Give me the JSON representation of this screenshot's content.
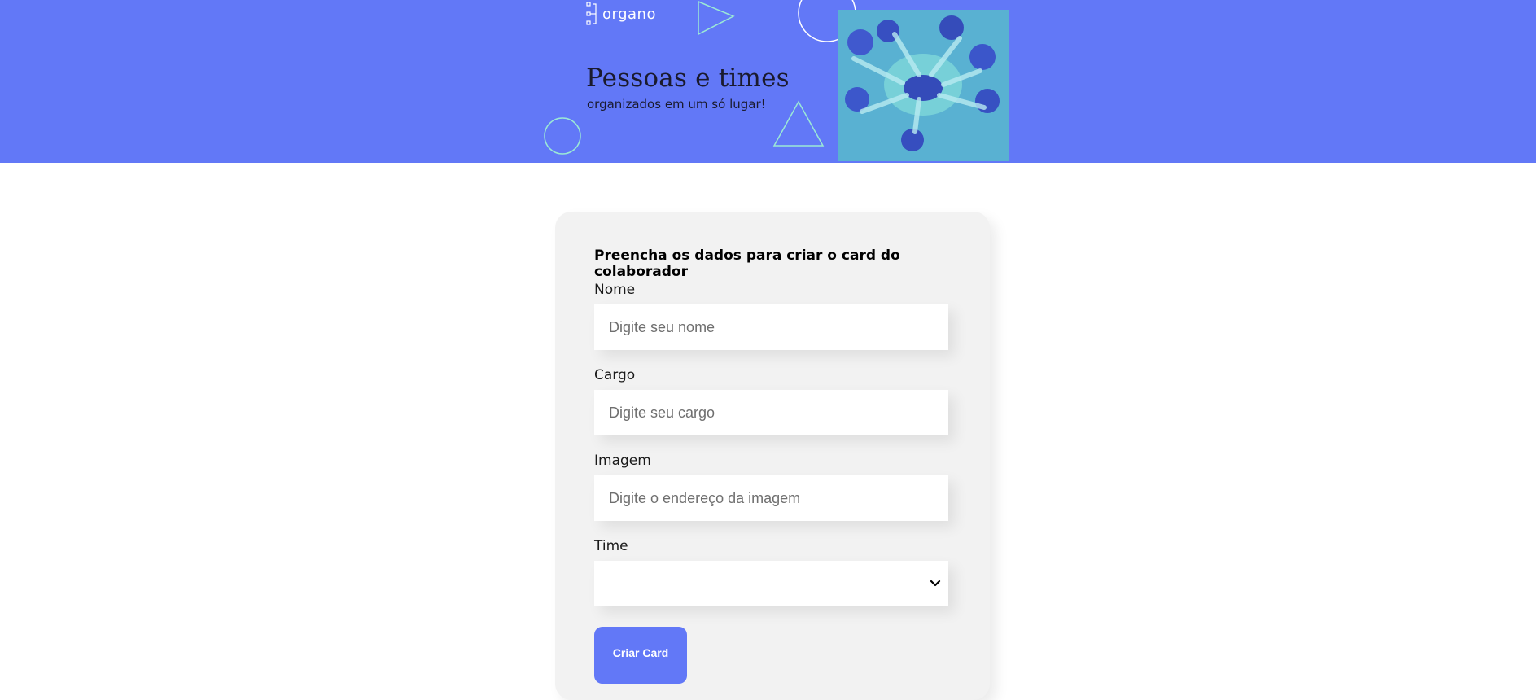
{
  "banner": {
    "logo_text": "organo",
    "headline": "Pessoas e times",
    "subline": "organizados em um só lugar!",
    "background_color": "#6278f7",
    "photo_tint": "#64e8c6"
  },
  "form": {
    "title": "Preencha os dados para criar o card do colaborador",
    "fields": {
      "nome": {
        "label": "Nome",
        "placeholder": "Digite seu nome",
        "value": ""
      },
      "cargo": {
        "label": "Cargo",
        "placeholder": "Digite seu cargo",
        "value": ""
      },
      "imagem": {
        "label": "Imagem",
        "placeholder": "Digite o endereço da imagem",
        "value": ""
      },
      "time": {
        "label": "Time",
        "selected": ""
      }
    },
    "submit_label": "Criar Card",
    "icons": {
      "select": "chevron-down-icon"
    }
  }
}
